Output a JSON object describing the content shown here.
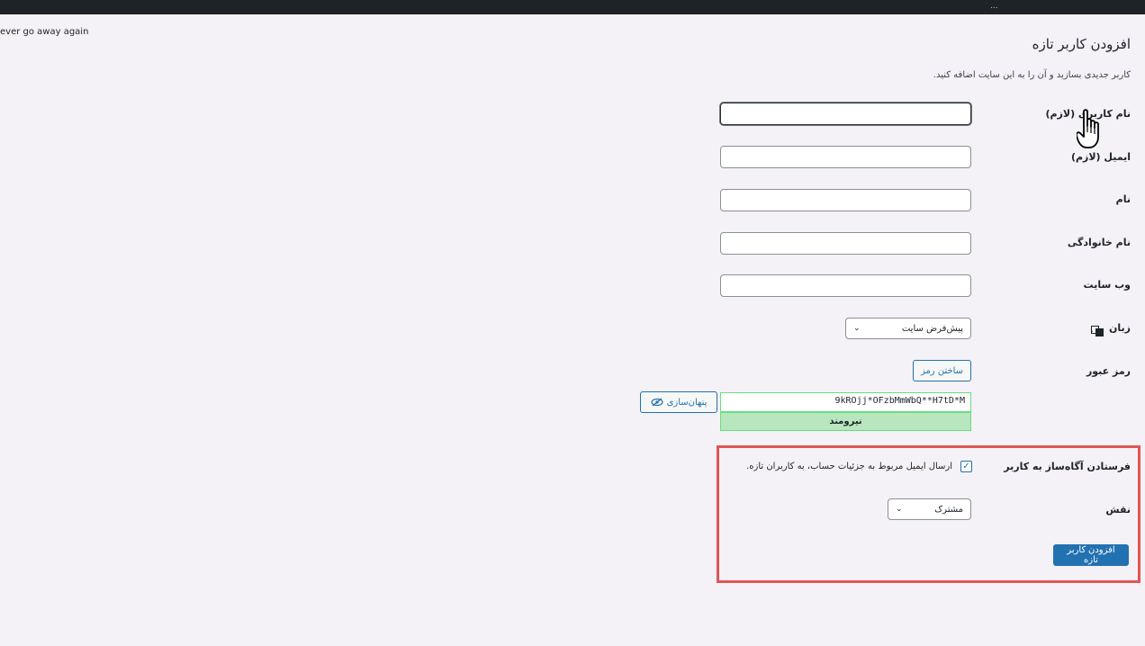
{
  "topbar": {
    "items": [
      "..."
    ]
  },
  "notice": {
    "text": "ever go away again"
  },
  "page": {
    "title": "افزودن کاربر تازه",
    "description": "کاربر جدیدی بسازید و آن را به این سایت اضافه کنید."
  },
  "form": {
    "username": {
      "label": "نام کاربری (لازم)",
      "value": ""
    },
    "email": {
      "label": "ایمیل (لازم)",
      "value": ""
    },
    "first_name": {
      "label": "نام",
      "value": ""
    },
    "last_name": {
      "label": "نام خانوادگی",
      "value": ""
    },
    "website": {
      "label": "وب سایت",
      "value": ""
    },
    "language": {
      "label": "زبان",
      "selected": "پیش‌فرض سایت"
    },
    "password": {
      "label": "رمز عبور",
      "generate_label": "ساختن رمز",
      "value": "9kROjj*OFzbMmWbQ**H7tD*M",
      "hide_label": "پنهان‌سازی",
      "strength": "نیرومند"
    },
    "notify": {
      "label": "فرستادن آگاه‌ساز به کاربر",
      "checkbox_text": "ارسال ایمیل مربوط به جزئیات حساب، به کاربران تازه.",
      "checked": true
    },
    "role": {
      "label": "نقش",
      "selected": "مشترک"
    },
    "submit_label": "افزودن کاربر تازه"
  },
  "colors": {
    "accent": "#2271b1",
    "highlight": "#e25555",
    "strength_bg": "#b8e6bf"
  }
}
